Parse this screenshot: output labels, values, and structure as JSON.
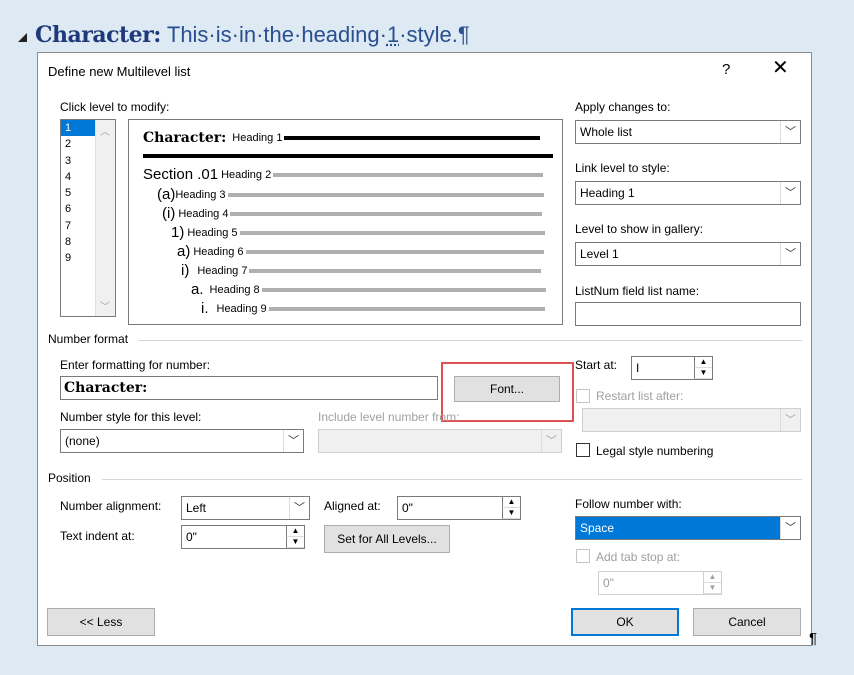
{
  "doc": {
    "heading_bold": "Character:",
    "heading_rest_a": "This·is·in·the·heading·",
    "heading_rest_num": "1",
    "heading_rest_b": "·style.¶",
    "pilcrow": "¶"
  },
  "dialog": {
    "title": "Define new Multilevel list",
    "help": "?",
    "close": "✕",
    "click_level_label": "Click level to modify:",
    "levels": [
      "1",
      "2",
      "3",
      "4",
      "5",
      "6",
      "7",
      "8",
      "9"
    ],
    "selected_level": "1",
    "preview": [
      {
        "num": "Character:",
        "heading": "Heading 1"
      },
      {
        "num": "Section .01",
        "heading": "Heading 2"
      },
      {
        "num": "(a)",
        "heading": "Heading 3"
      },
      {
        "num": "(i)",
        "heading": "Heading 4"
      },
      {
        "num": "1)",
        "heading": "Heading 5"
      },
      {
        "num": "a)",
        "heading": "Heading 6"
      },
      {
        "num": "i)",
        "heading": "Heading 7"
      },
      {
        "num": "a.",
        "heading": "Heading 8"
      },
      {
        "num": "i.",
        "heading": "Heading 9"
      }
    ],
    "apply_changes_label": "Apply changes to:",
    "apply_changes_value": "Whole list",
    "link_level_label": "Link level to style:",
    "link_level_value": "Heading 1",
    "gallery_label": "Level to show in gallery:",
    "gallery_value": "Level 1",
    "listnum_label": "ListNum field list name:",
    "listnum_value": "",
    "number_format_label": "Number format",
    "enter_formatting_label": "Enter formatting for number:",
    "enter_formatting_value": "Character:",
    "font_button": "Font...",
    "number_style_label": "Number style for this level:",
    "number_style_value": "(none)",
    "include_level_label": "Include level number from:",
    "include_level_value": "",
    "start_at_label": "Start at:",
    "start_at_value": "I",
    "restart_label": "Restart list after:",
    "legal_label": "Legal style numbering",
    "position_label": "Position",
    "alignment_label": "Number alignment:",
    "alignment_value": "Left",
    "aligned_at_label": "Aligned at:",
    "aligned_at_value": "0\"",
    "text_indent_label": "Text indent at:",
    "text_indent_value": "0\"",
    "set_all_button": "Set for All Levels...",
    "follow_label": "Follow number with:",
    "follow_value": "Space",
    "add_tab_label": "Add tab stop at:",
    "add_tab_value": "0\"",
    "less_button": "<< Less",
    "ok_button": "OK",
    "cancel_button": "Cancel"
  },
  "colors": {
    "selection": "#0078d7",
    "highlight_box": "#e05050",
    "doc_heading": "#1f3a7a"
  }
}
